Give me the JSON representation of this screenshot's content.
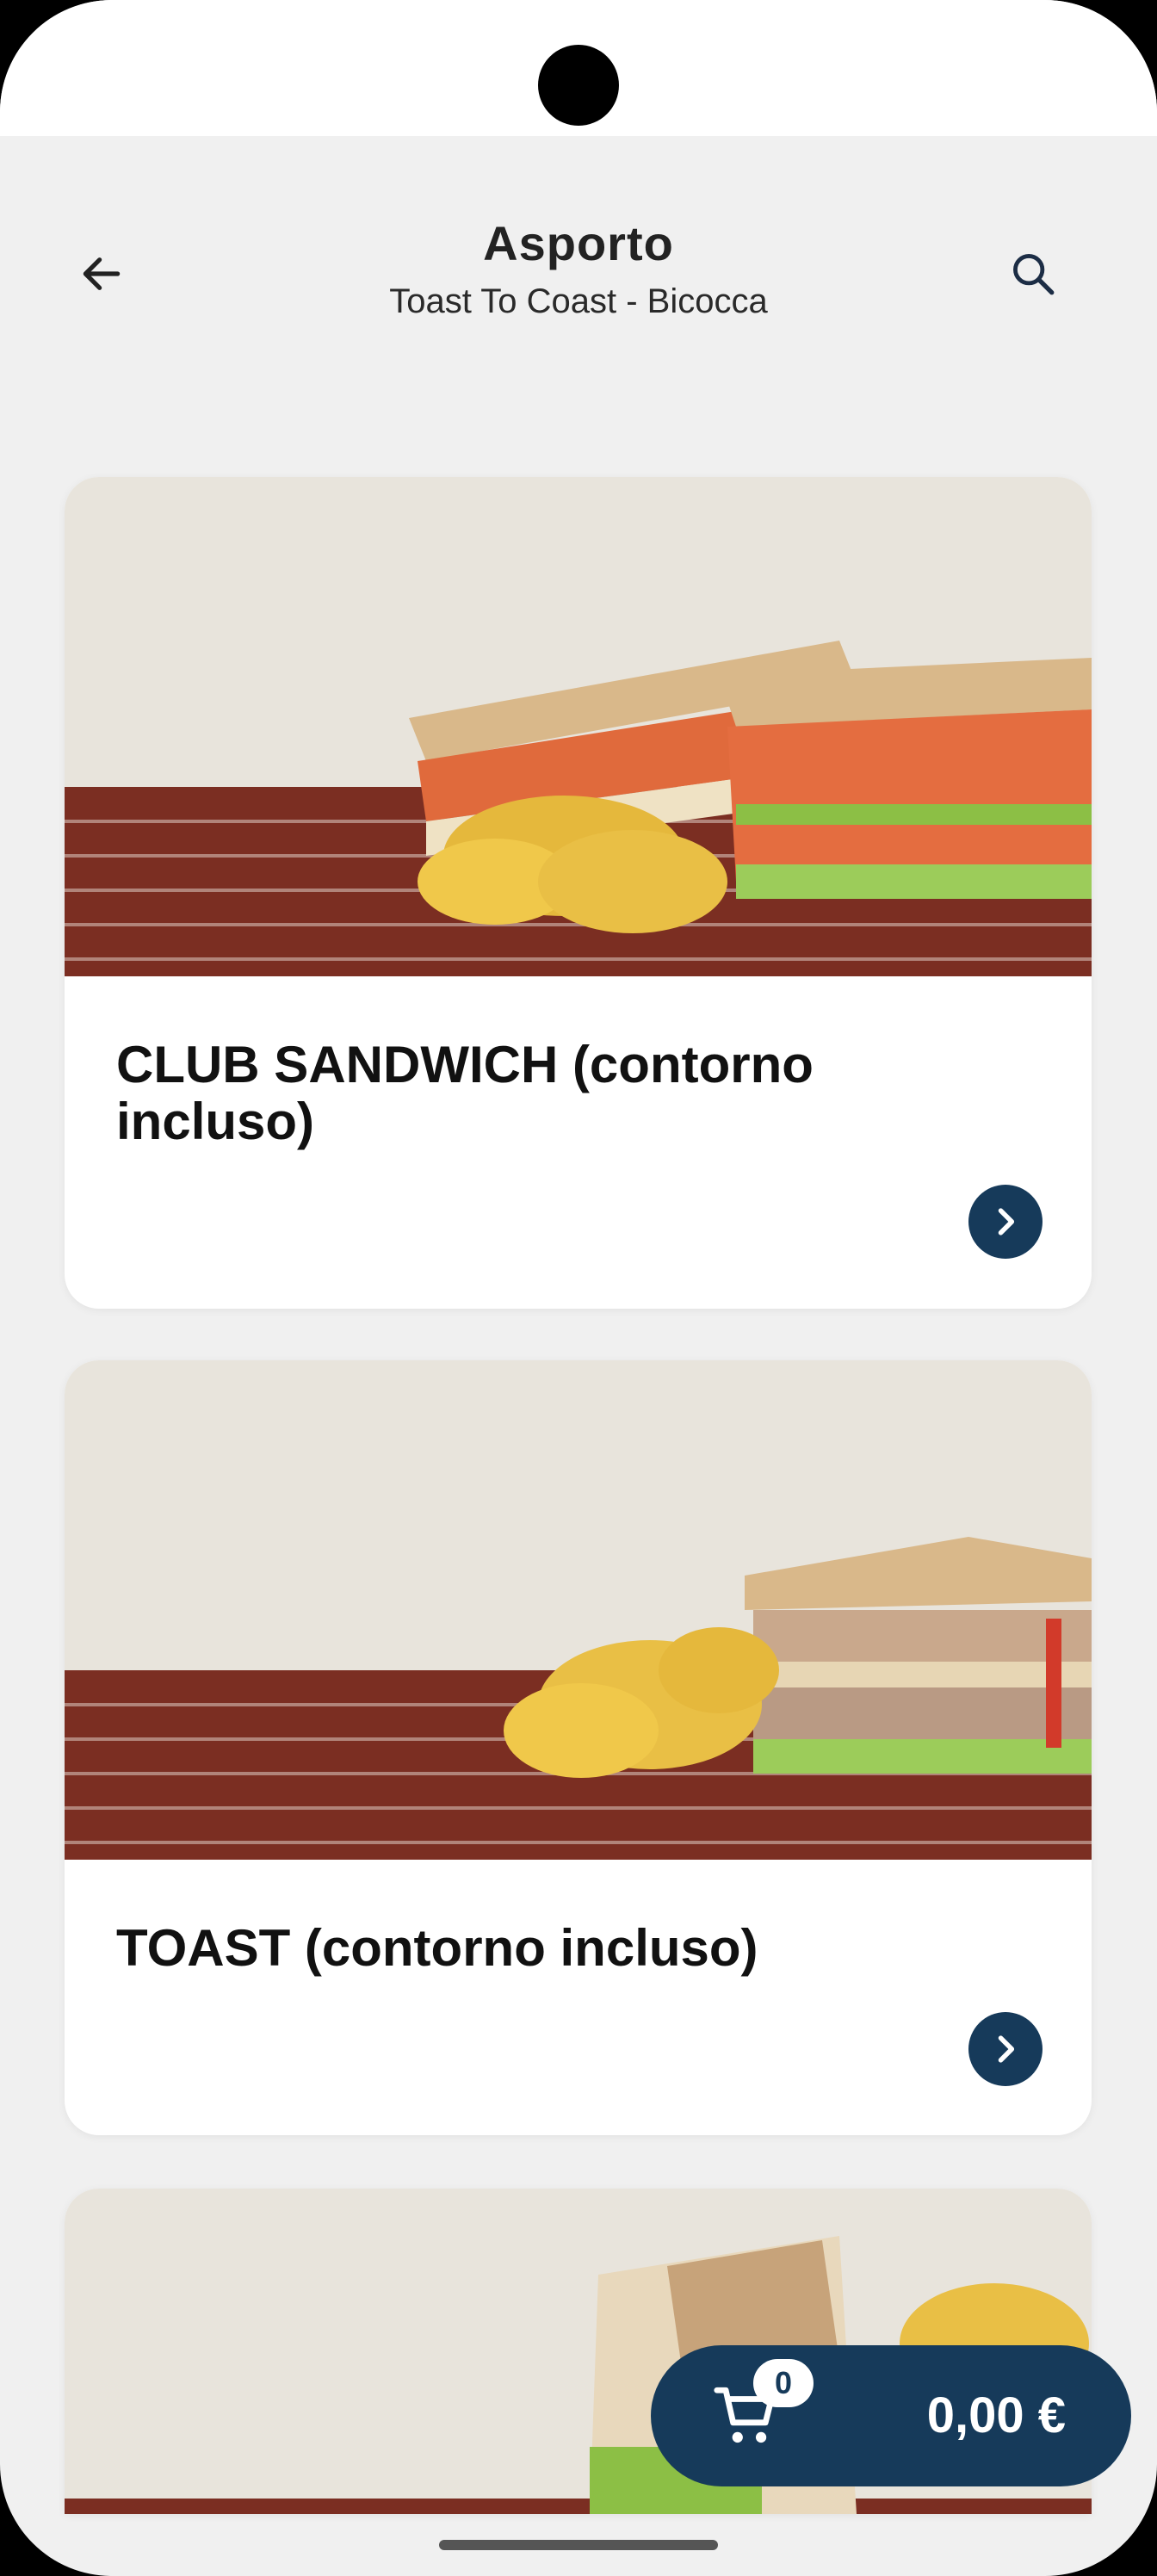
{
  "header": {
    "title": "Asporto",
    "subtitle": "Toast To Coast - Bicocca"
  },
  "icons": {
    "back": "arrow-left-icon",
    "search": "search-icon",
    "chevron": "chevron-right-icon",
    "cart": "shopping-cart-icon"
  },
  "products": [
    {
      "name": "CLUB SANDWICH (contorno incluso)"
    },
    {
      "name": "TOAST (contorno incluso)"
    }
  ],
  "cart": {
    "count": "0",
    "total": "0,00 €"
  },
  "colors": {
    "accent": "#163a5a",
    "background": "#f0f0f0",
    "card": "#ffffff"
  }
}
